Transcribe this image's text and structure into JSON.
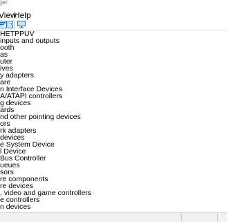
{
  "window": {
    "title": "ger"
  },
  "menu": {
    "items": [
      {
        "label": "View"
      },
      {
        "label": "Help"
      }
    ]
  },
  "tree": {
    "items": [
      {
        "label": "HETPPUV"
      },
      {
        "label": "inputs and outputs"
      },
      {
        "label": "ooth"
      },
      {
        "label": "as"
      },
      {
        "label": "uter"
      },
      {
        "label": "ives"
      },
      {
        "label": "y adapters"
      },
      {
        "label": "are"
      },
      {
        "label": "n Interface Devices"
      },
      {
        "label": "A/ATAPI controllers"
      },
      {
        "label": "g devices"
      },
      {
        "label": "ards"
      },
      {
        "label": "nd other pointing devices"
      },
      {
        "label": "ors"
      },
      {
        "label": "rk adapters"
      },
      {
        "label": "devices"
      },
      {
        "label": "e System Device"
      },
      {
        "label": "l Device"
      },
      {
        "label": "Bus Controller"
      },
      {
        "label": "ueues"
      },
      {
        "label": "sors"
      },
      {
        "label": "re components"
      },
      {
        "label": "re devices"
      },
      {
        "label": ", video and game controllers"
      },
      {
        "label": "e controllers"
      },
      {
        "label": "n devices"
      }
    ]
  },
  "colors": {
    "accent": "#0078d7",
    "toolbar_icon_blue": "#1f6fb2"
  }
}
